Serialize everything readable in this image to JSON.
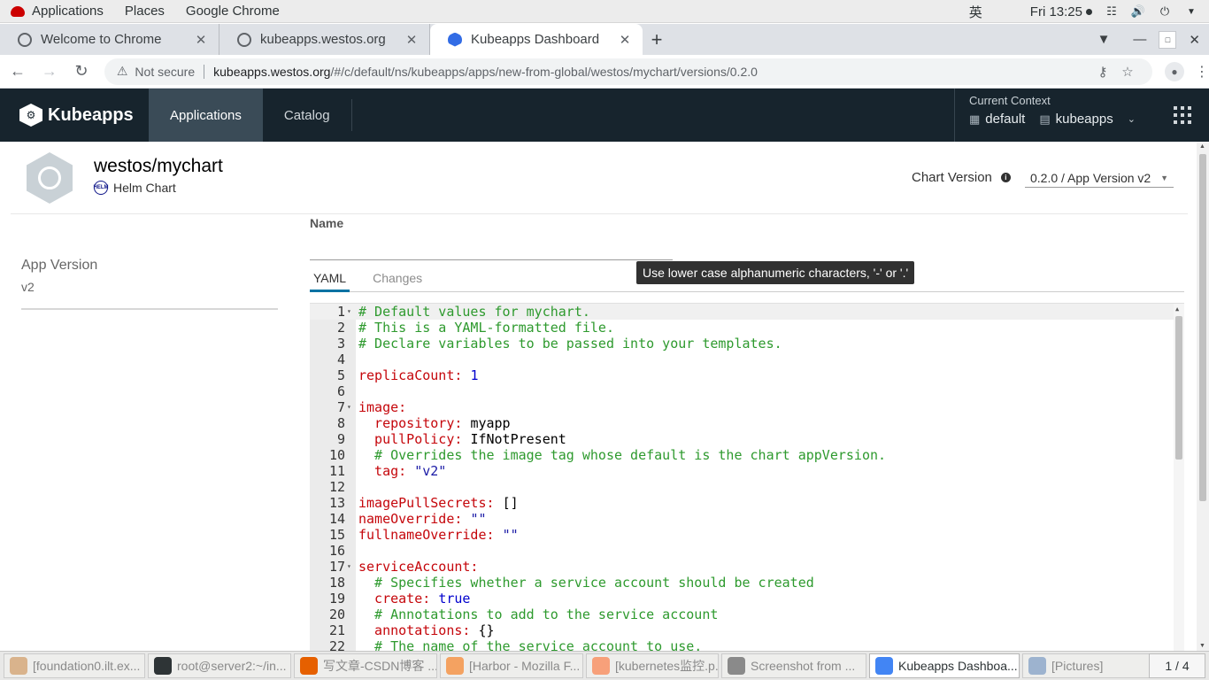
{
  "system_bar": {
    "menus": [
      "Applications",
      "Places",
      "Google Chrome"
    ],
    "input_method": "英",
    "clock": "Fri 13:25"
  },
  "browser": {
    "tabs": [
      {
        "label": "Welcome to Chrome",
        "active": false
      },
      {
        "label": "kubeapps.westos.org",
        "active": false
      },
      {
        "label": "Kubeapps Dashboard",
        "active": true
      }
    ],
    "security_label": "Not secure",
    "url_host": "kubeapps.westos.org",
    "url_path": "/#/c/default/ns/kubeapps/apps/new-from-global/westos/mychart/versions/0.2.0"
  },
  "kubeapps": {
    "brand": "Kubeapps",
    "nav": [
      {
        "label": "Applications",
        "active": true
      },
      {
        "label": "Catalog",
        "active": false
      }
    ],
    "context": {
      "label": "Current Context",
      "cluster": "default",
      "namespace": "kubeapps"
    }
  },
  "chart": {
    "title": "westos/mychart",
    "subtitle": "Helm Chart",
    "helm_badge": "HELM",
    "version_label": "Chart Version",
    "version_value": "0.2.0 / App Version v2"
  },
  "sidebar": {
    "app_version_label": "App Version",
    "app_version_value": "v2"
  },
  "form": {
    "name_label": "Name",
    "name_value": "",
    "tooltip": "Use lower case alphanumeric characters, '-' or '.'",
    "tabs": [
      {
        "label": "YAML",
        "active": true
      },
      {
        "label": "Changes",
        "active": false
      }
    ]
  },
  "editor": {
    "lines": [
      {
        "n": "1",
        "fold": true,
        "parts": [
          [
            "comment",
            "# Default values for mychart."
          ]
        ]
      },
      {
        "n": "2",
        "parts": [
          [
            "comment",
            "# This is a YAML-formatted file."
          ]
        ]
      },
      {
        "n": "3",
        "parts": [
          [
            "comment",
            "# Declare variables to be passed into your templates."
          ]
        ]
      },
      {
        "n": "4",
        "parts": []
      },
      {
        "n": "5",
        "parts": [
          [
            "key",
            "replicaCount: "
          ],
          [
            "num",
            "1"
          ]
        ]
      },
      {
        "n": "6",
        "parts": []
      },
      {
        "n": "7",
        "fold": true,
        "parts": [
          [
            "key",
            "image:"
          ]
        ]
      },
      {
        "n": "8",
        "parts": [
          [
            "key",
            "  repository: "
          ],
          [
            "plain",
            "myapp"
          ]
        ]
      },
      {
        "n": "9",
        "parts": [
          [
            "key",
            "  pullPolicy: "
          ],
          [
            "plain",
            "IfNotPresent"
          ]
        ]
      },
      {
        "n": "10",
        "parts": [
          [
            "comment",
            "  # Overrides the image tag whose default is the chart appVersion."
          ]
        ]
      },
      {
        "n": "11",
        "parts": [
          [
            "key",
            "  tag: "
          ],
          [
            "str",
            "\"v2\""
          ]
        ]
      },
      {
        "n": "12",
        "parts": []
      },
      {
        "n": "13",
        "parts": [
          [
            "key",
            "imagePullSecrets: "
          ],
          [
            "plain",
            "[]"
          ]
        ]
      },
      {
        "n": "14",
        "parts": [
          [
            "key",
            "nameOverride: "
          ],
          [
            "str",
            "\"\""
          ]
        ]
      },
      {
        "n": "15",
        "parts": [
          [
            "key",
            "fullnameOverride: "
          ],
          [
            "str",
            "\"\""
          ]
        ]
      },
      {
        "n": "16",
        "parts": []
      },
      {
        "n": "17",
        "fold": true,
        "parts": [
          [
            "key",
            "serviceAccount:"
          ]
        ]
      },
      {
        "n": "18",
        "parts": [
          [
            "comment",
            "  # Specifies whether a service account should be created"
          ]
        ]
      },
      {
        "n": "19",
        "parts": [
          [
            "key",
            "  create: "
          ],
          [
            "num",
            "true"
          ]
        ]
      },
      {
        "n": "20",
        "parts": [
          [
            "comment",
            "  # Annotations to add to the service account"
          ]
        ]
      },
      {
        "n": "21",
        "parts": [
          [
            "key",
            "  annotations: "
          ],
          [
            "plain",
            "{}"
          ]
        ]
      },
      {
        "n": "22",
        "parts": [
          [
            "comment",
            "  # The name of the service account to use."
          ]
        ]
      }
    ]
  },
  "taskbar": {
    "items": [
      {
        "label": "[foundation0.ilt.ex...",
        "icon_color": "#d9b38c",
        "active": false
      },
      {
        "label": "root@server2:~/in...",
        "icon_color": "#2e3436",
        "active": false
      },
      {
        "label": "写文章-CSDN博客 ...",
        "icon_color": "#e66000",
        "active": false
      },
      {
        "label": "[Harbor - Mozilla F...",
        "icon_color": "#f4a261",
        "active": false
      },
      {
        "label": "[kubernetes监控.p...",
        "icon_color": "#f7a07a",
        "active": false
      },
      {
        "label": "Screenshot from ...",
        "icon_color": "#8a8a8a",
        "active": false
      },
      {
        "label": "Kubeapps Dashboa...",
        "icon_color": "#4285f4",
        "active": true
      },
      {
        "label": "[Pictures]",
        "icon_color": "#9db3cf",
        "active": false
      }
    ],
    "pager": "1 / 4"
  }
}
